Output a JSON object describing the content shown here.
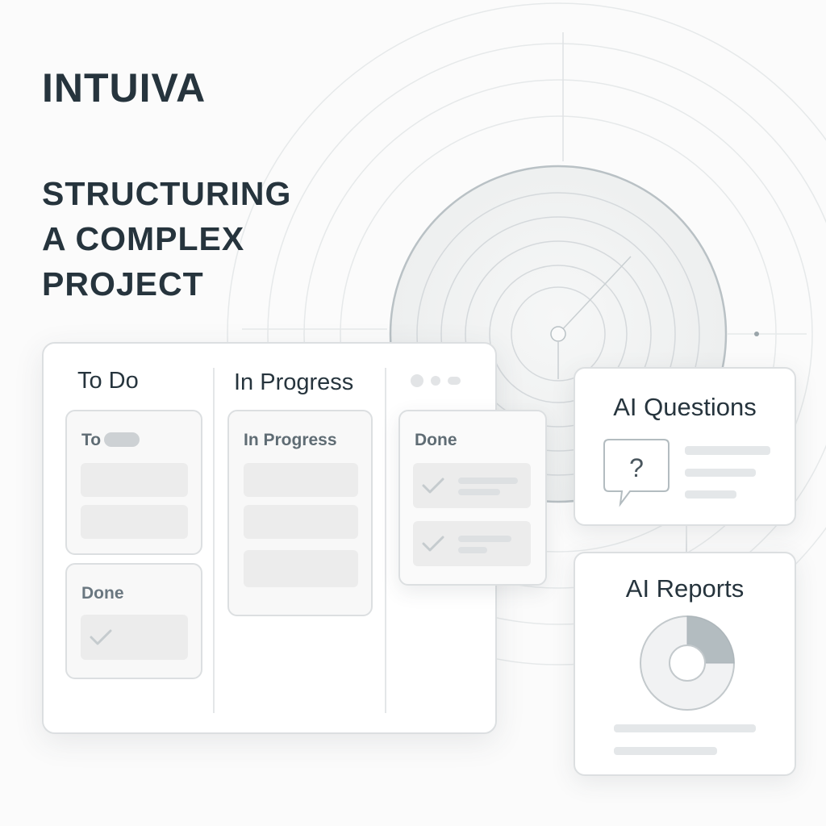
{
  "brand": {
    "name": "INTUIVA"
  },
  "headline": {
    "lines": [
      "STRUCTURING",
      "A COMPLEX",
      "PROJECT"
    ]
  },
  "board": {
    "columns": [
      {
        "title": "To Do"
      },
      {
        "title": "In Progress"
      }
    ],
    "cards": {
      "todo_card": {
        "title": "To"
      },
      "done_card_left": {
        "title": "Done"
      },
      "in_progress_card": {
        "title": "In Progress"
      },
      "done_card_floating": {
        "title": "Done"
      }
    }
  },
  "panels": {
    "ai_questions": {
      "title": "AI Questions",
      "icon": "question-bubble-icon"
    },
    "ai_reports": {
      "title": "AI Reports",
      "icon": "donut-chart-icon",
      "highlighted_fraction": 0.25
    }
  },
  "colors": {
    "text_dark": "#26343d",
    "card_border": "#dcdfe1",
    "placeholder": "#ececec",
    "accent_gray": "#b3bcc0"
  }
}
